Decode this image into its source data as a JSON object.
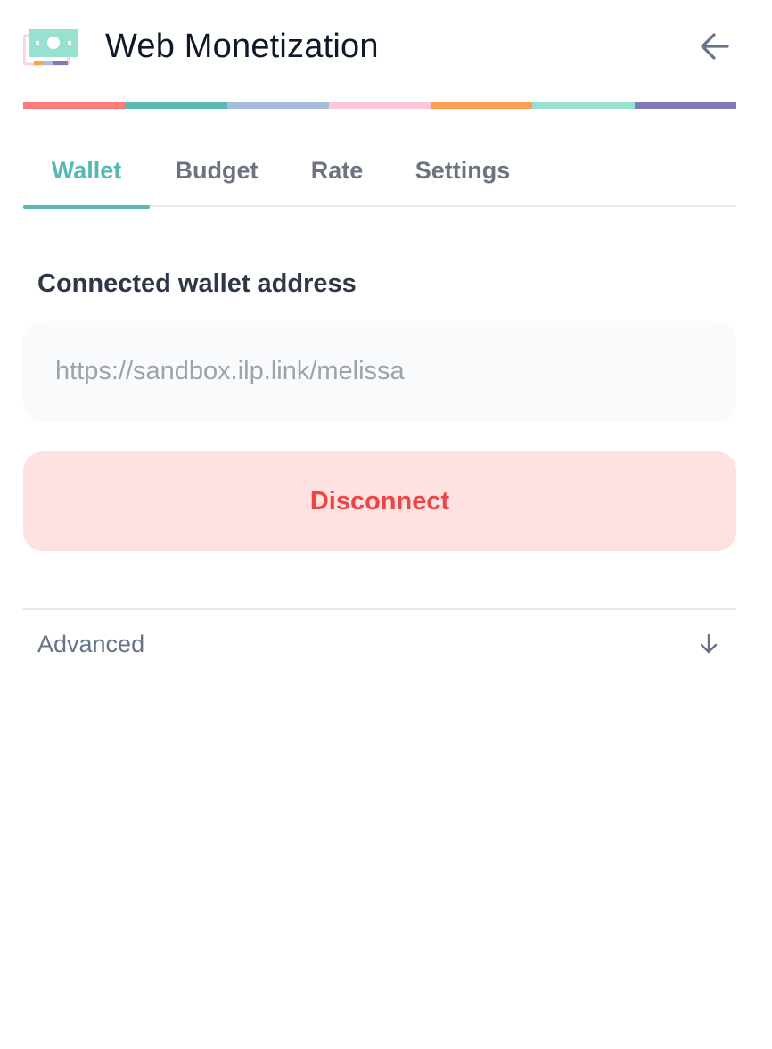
{
  "header": {
    "title": "Web Monetization"
  },
  "icons": {
    "logo": "web-monetization-logo",
    "back": "arrow-left-icon",
    "advanced_toggle": "arrow-down-icon"
  },
  "colors": {
    "accent": "#56b7b5",
    "danger_text": "#ef4444",
    "danger_bg": "#fde2e1",
    "stripe": [
      "#ff7b7b",
      "#5bb8b4",
      "#a6bfd8",
      "#fdc6d8",
      "#ff9f55",
      "#98e1d0",
      "#8479b8"
    ]
  },
  "tabs": [
    {
      "label": "Wallet",
      "active": true
    },
    {
      "label": "Budget",
      "active": false
    },
    {
      "label": "Rate",
      "active": false
    },
    {
      "label": "Settings",
      "active": false
    }
  ],
  "wallet": {
    "section_label": "Connected wallet address",
    "address": "https://sandbox.ilp.link/melissa",
    "disconnect_label": "Disconnect"
  },
  "advanced": {
    "label": "Advanced"
  }
}
